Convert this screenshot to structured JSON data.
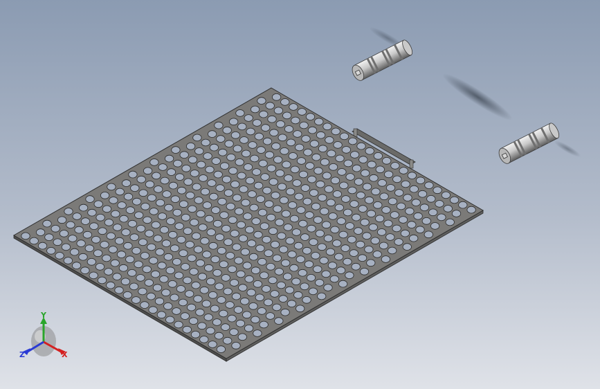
{
  "viewport": {
    "background_top": "#8b9bb2",
    "background_bottom": "#dfe2e8"
  },
  "model": {
    "plate": {
      "face_color": "#7b7a78",
      "edge_color": "#2e2e2e",
      "hole_fill": "#a7b1c2",
      "hole_columns": 25,
      "hole_rows": 24
    },
    "pins": [
      {
        "name": "pin-upper-right",
        "body_color": "#b8b8b8"
      },
      {
        "name": "pin-right",
        "body_color": "#b8b8b8"
      }
    ]
  },
  "triad": {
    "y_label": "Y",
    "x_label": "X",
    "z_label": "Z",
    "y_color": "#2aa52a",
    "x_color": "#d42020",
    "z_color": "#2a3ad4"
  }
}
